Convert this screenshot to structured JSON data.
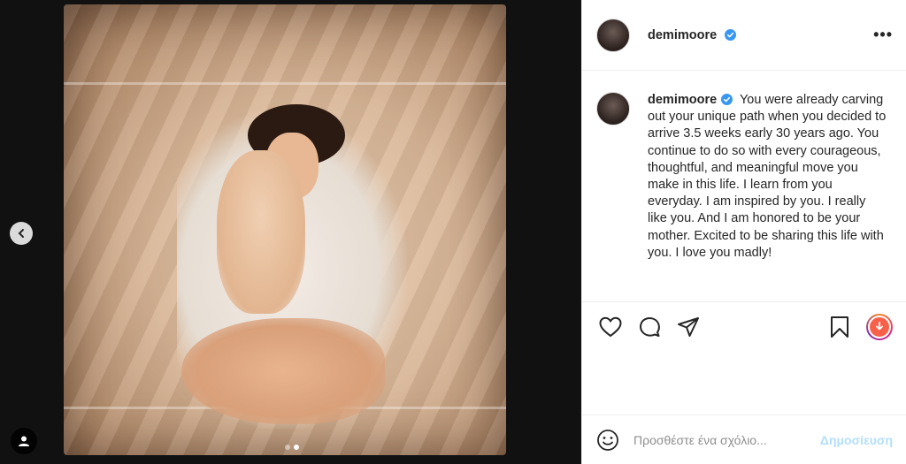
{
  "post": {
    "username": "demimoore",
    "caption": "You were already carving out your unique path when you decided to arrive 3.5 weeks early 30 years ago. You continue to do so with every courageous, thoughtful, and meaningful move you make in this life. I learn from you everyday. I am inspired by you. I really like you. And I am honored to be your mother. Excited to be sharing this life with you. I love you madly!",
    "more_label": "•••"
  },
  "comment": {
    "placeholder": "Προσθέστε ένα σχόλιο...",
    "post_label": "Δημοσίευση"
  },
  "carousel": {
    "count": 2,
    "active_index": 1
  },
  "colors": {
    "verified": "#3897f0",
    "post_disabled": "#b2dffc"
  },
  "icons": [
    "chevron-left-icon",
    "user-tag-icon",
    "heart-icon",
    "comment-icon",
    "share-icon",
    "bookmark-icon",
    "emoji-icon",
    "verified-badge-icon"
  ]
}
